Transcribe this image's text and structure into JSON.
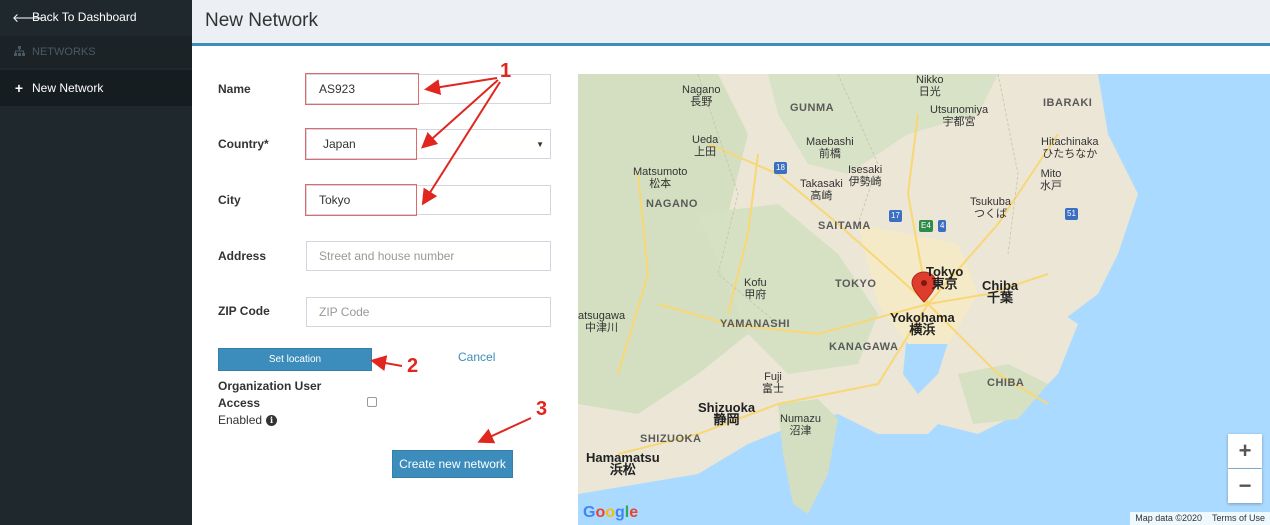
{
  "sidebar": {
    "back_label": "Back To Dashboard",
    "section_label": "NETWORKS",
    "new_network_label": "New Network"
  },
  "header": {
    "title": "New Network"
  },
  "form": {
    "name": {
      "label": "Name",
      "value": "AS923"
    },
    "country": {
      "label": "Country*",
      "value": "Japan"
    },
    "city": {
      "label": "City",
      "value": "Tokyo"
    },
    "address": {
      "label": "Address",
      "placeholder": "Street and house number"
    },
    "zip": {
      "label": "ZIP Code",
      "placeholder": "ZIP Code"
    },
    "set_location_label": "Set location",
    "cancel_label": "Cancel",
    "org_access_label_1": "Organization User",
    "org_access_label_2": "Access",
    "enabled_label": "Enabled",
    "org_access_enabled": false,
    "create_label": "Create new network"
  },
  "annotations": {
    "one": "1",
    "two": "2",
    "three": "3"
  },
  "map": {
    "labels": {
      "nikko": "Nikko",
      "nikko_jp": "日光",
      "nagano": "Nagano",
      "nagano_jp": "長野",
      "gunma": "GUNMA",
      "utsunomiya": "Utsunomiya",
      "utsunomiya_jp": "宇都宮",
      "ibaraki": "IBARAKI",
      "ueda": "Ueda",
      "ueda_jp": "上田",
      "maebashi": "Maebashi",
      "maebashi_jp": "前橋",
      "hitachinaka": "Hitachinaka",
      "hitachinaka_jp": "ひたちなか",
      "matsumoto": "Matsumoto",
      "matsumoto_jp": "松本",
      "isesaki": "Isesaki",
      "isesaki_jp": "伊勢崎",
      "takasaki": "Takasaki",
      "takasaki_jp": "高崎",
      "mito": "Mito",
      "mito_jp": "水戸",
      "nagano_pref": "NAGANO",
      "tsukuba": "Tsukuba",
      "tsukuba_jp": "つくば",
      "saitama": "SAITAMA",
      "kofu": "Kofu",
      "kofu_jp": "甲府",
      "tokyo_pref": "TOKYO",
      "tokyo": "Tokyo",
      "tokyo_jp": "東京",
      "chiba": "Chiba",
      "chiba_jp": "千葉",
      "katsugawa": "atsugawa",
      "katsugawa_jp": "中津川",
      "yamanashi": "YAMANASHI",
      "yokohama": "Yokohama",
      "yokohama_jp": "横浜",
      "kanagawa": "KANAGAWA",
      "fuji": "Fuji",
      "fuji_jp": "富士",
      "chiba_pref": "CHIBA",
      "shizuoka": "Shizuoka",
      "shizuoka_jp": "静岡",
      "numazu": "Numazu",
      "numazu_jp": "沼津",
      "shizuoka_pref": "SHIZUOKA",
      "hamamatsu": "Hamamatsu",
      "hamamatsu_jp": "浜松",
      "route_18": "18",
      "route_17": "17",
      "route_e4": "E4",
      "route_4": "4",
      "route_51": "51"
    },
    "zoom_in": "+",
    "zoom_out": "−",
    "attribution": "Map data ©2020",
    "terms": "Terms of Use",
    "logo": "Google",
    "colors": {
      "land": "#ebe6d6",
      "forest": "#d3dfc0",
      "water": "#aadaff",
      "urban": "#f5eac8",
      "road": "#f8d774",
      "marker": "#e03c2e"
    }
  }
}
